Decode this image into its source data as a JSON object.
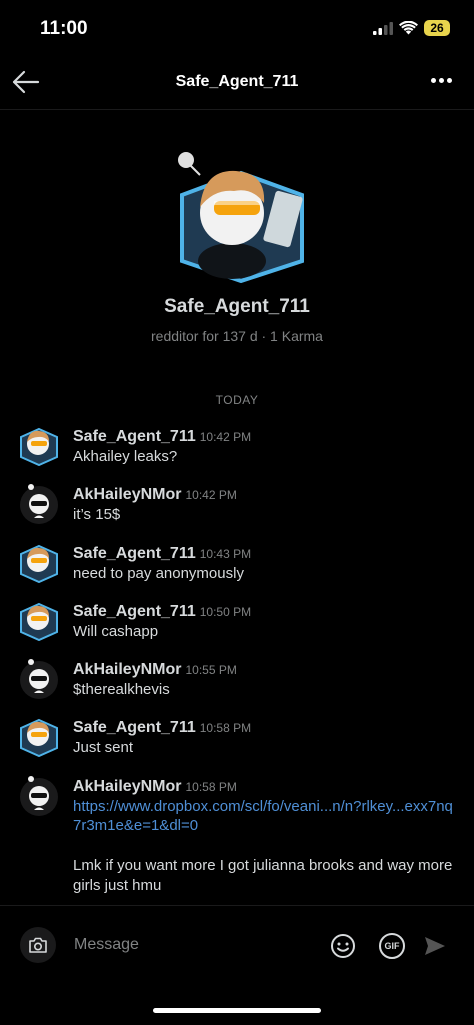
{
  "status": {
    "time": "11:00",
    "battery": "26"
  },
  "header": {
    "title": "Safe_Agent_711"
  },
  "profile": {
    "name": "Safe_Agent_711",
    "meta": "redditor for 137 d · 1 Karma"
  },
  "date_separator": "TODAY",
  "messages": [
    {
      "user": "Safe_Agent_711",
      "time": "10:42 PM",
      "text": "Akhailey leaks?",
      "avatar": "snoo-orange-hair-sunglasses"
    },
    {
      "user": "AkHaileyNMor",
      "time": "10:42 PM",
      "text": "it’s 15$",
      "avatar": "snoo-dark-sunglasses"
    },
    {
      "user": "Safe_Agent_711",
      "time": "10:43 PM",
      "text": "need to pay anonymously",
      "avatar": "snoo-orange-hair-sunglasses"
    },
    {
      "user": "Safe_Agent_711",
      "time": "10:50 PM",
      "text": "Will cashapp",
      "avatar": "snoo-orange-hair-sunglasses"
    },
    {
      "user": "AkHaileyNMor",
      "time": "10:55 PM",
      "text": "$therealkhevis",
      "avatar": "snoo-dark-sunglasses"
    },
    {
      "user": "Safe_Agent_711",
      "time": "10:58 PM",
      "text": "Just sent",
      "avatar": "snoo-orange-hair-sunglasses"
    },
    {
      "user": "AkHaileyNMor",
      "time": "10:58 PM",
      "link": "https://www.dropbox.com/scl/fo/veani...n/n?rlkey...exx7nq7r3m1e&e=1&dl=0",
      "text": "Lmk if you want more I got julianna brooks and way more girls just hmu",
      "avatar": "snoo-dark-sunglasses"
    }
  ],
  "composer": {
    "placeholder": "Message",
    "gif_label": "GIF"
  },
  "colors": {
    "background": "#000000",
    "text": "#d7dadc",
    "muted": "#818384",
    "link": "#4f8fd6",
    "battery": "#e8d44d"
  }
}
